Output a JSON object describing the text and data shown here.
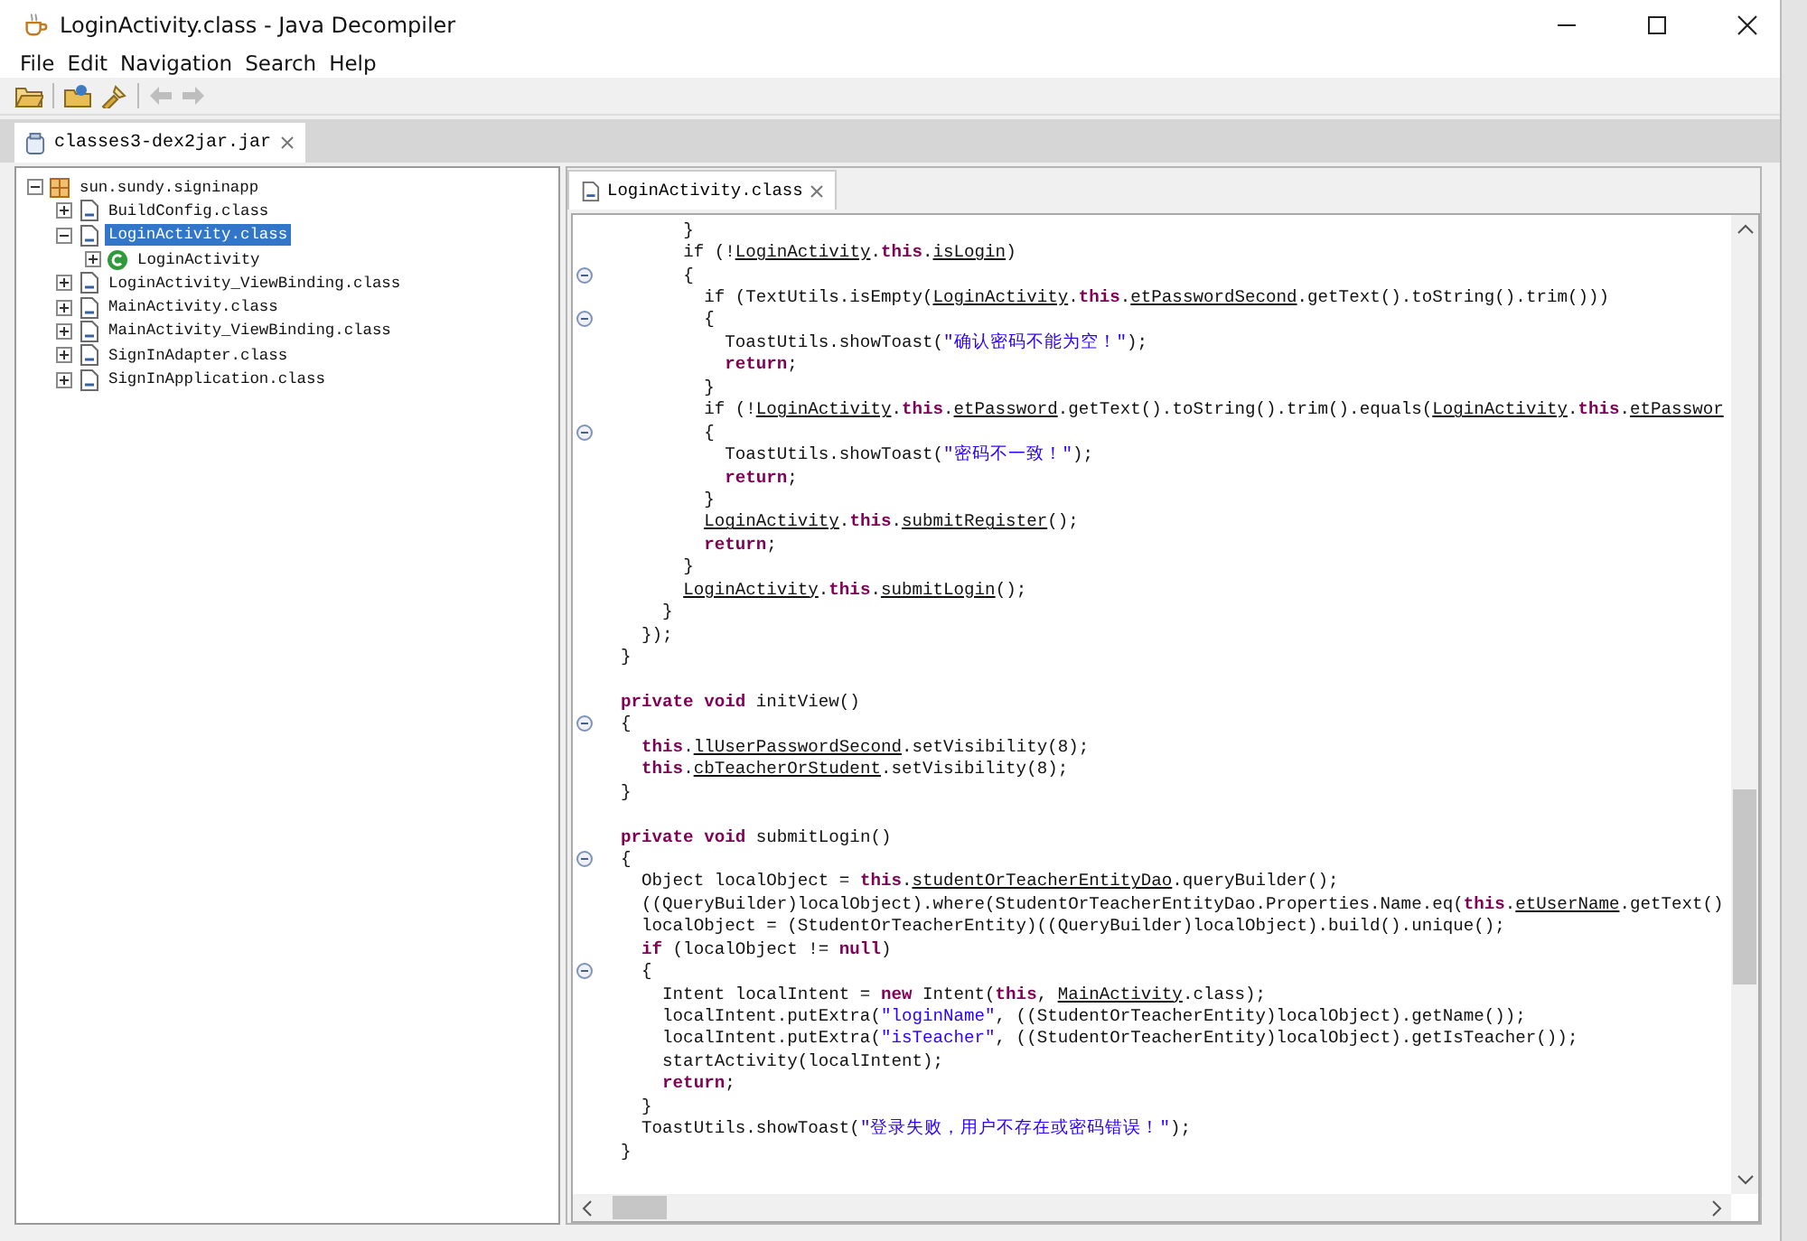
{
  "window": {
    "title": "LoginActivity.class - Java Decompiler"
  },
  "menu": [
    "File",
    "Edit",
    "Navigation",
    "Search",
    "Help"
  ],
  "toolbar": [
    {
      "kind": "open",
      "disabled": false
    },
    {
      "kind": "open-type",
      "disabled": false
    },
    {
      "kind": "search",
      "disabled": false
    },
    {
      "kind": "back",
      "disabled": true
    },
    {
      "kind": "forward",
      "disabled": true
    }
  ],
  "left_tabs": [
    {
      "label": "classes3-dex2jar.jar",
      "selected": true
    }
  ],
  "tree": [
    {
      "label": "sun.sundy.signinapp",
      "kind": "package",
      "expanded": true,
      "selected": false,
      "children": [
        {
          "label": "BuildConfig.class",
          "kind": "classfile",
          "expanded": false,
          "selected": false
        },
        {
          "label": "LoginActivity.class",
          "kind": "classfile",
          "expanded": true,
          "selected": true,
          "children": [
            {
              "label": "LoginActivity",
              "kind": "class",
              "expanded": false,
              "selected": false
            }
          ]
        },
        {
          "label": "LoginActivity_ViewBinding.class",
          "kind": "classfile",
          "expanded": false,
          "selected": false
        },
        {
          "label": "MainActivity.class",
          "kind": "classfile",
          "expanded": false,
          "selected": false
        },
        {
          "label": "MainActivity_ViewBinding.class",
          "kind": "classfile",
          "expanded": false,
          "selected": false
        },
        {
          "label": "SignInAdapter.class",
          "kind": "classfile",
          "expanded": false,
          "selected": false
        },
        {
          "label": "SignInApplication.class",
          "kind": "classfile",
          "expanded": false,
          "selected": false
        }
      ]
    }
  ],
  "editor_tabs": [
    {
      "label": "LoginActivity.class",
      "selected": true
    }
  ],
  "code": [
    {
      "kind": "code",
      "fold": false,
      "segments": [
        {
          "kind": "plain",
          "text": "        }"
        }
      ]
    },
    {
      "kind": "code",
      "fold": false,
      "segments": [
        {
          "kind": "plain",
          "text": "        if (!"
        },
        {
          "kind": "link",
          "text": "LoginActivity"
        },
        {
          "kind": "plain",
          "text": "."
        },
        {
          "kind": "keyword",
          "text": "this"
        },
        {
          "kind": "plain",
          "text": "."
        },
        {
          "kind": "link",
          "text": "isLogin"
        },
        {
          "kind": "plain",
          "text": ")"
        }
      ]
    },
    {
      "kind": "code",
      "fold": true,
      "segments": [
        {
          "kind": "plain",
          "text": "        {"
        }
      ]
    },
    {
      "kind": "code",
      "fold": false,
      "segments": [
        {
          "kind": "plain",
          "text": "          if (TextUtils.isEmpty("
        },
        {
          "kind": "link",
          "text": "LoginActivity"
        },
        {
          "kind": "plain",
          "text": "."
        },
        {
          "kind": "keyword",
          "text": "this"
        },
        {
          "kind": "plain",
          "text": "."
        },
        {
          "kind": "link",
          "text": "etPasswordSecond"
        },
        {
          "kind": "plain",
          "text": ".getText().toString().trim()))"
        }
      ]
    },
    {
      "kind": "code",
      "fold": true,
      "segments": [
        {
          "kind": "plain",
          "text": "          {"
        }
      ]
    },
    {
      "kind": "code",
      "fold": false,
      "segments": [
        {
          "kind": "plain",
          "text": "            ToastUtils.showToast("
        },
        {
          "kind": "string",
          "text": "\"确认密码不能为空！\""
        },
        {
          "kind": "plain",
          "text": ");"
        }
      ]
    },
    {
      "kind": "code",
      "fold": false,
      "segments": [
        {
          "kind": "keyword",
          "text": "            return"
        },
        {
          "kind": "plain",
          "text": ";"
        }
      ]
    },
    {
      "kind": "code",
      "fold": false,
      "segments": [
        {
          "kind": "plain",
          "text": "          }"
        }
      ]
    },
    {
      "kind": "code",
      "fold": false,
      "segments": [
        {
          "kind": "plain",
          "text": "          if (!"
        },
        {
          "kind": "link",
          "text": "LoginActivity"
        },
        {
          "kind": "plain",
          "text": "."
        },
        {
          "kind": "keyword",
          "text": "this"
        },
        {
          "kind": "plain",
          "text": "."
        },
        {
          "kind": "link",
          "text": "etPassword"
        },
        {
          "kind": "plain",
          "text": ".getText().toString().trim().equals("
        },
        {
          "kind": "link",
          "text": "LoginActivity"
        },
        {
          "kind": "plain",
          "text": "."
        },
        {
          "kind": "keyword",
          "text": "this"
        },
        {
          "kind": "plain",
          "text": "."
        },
        {
          "kind": "link",
          "text": "etPasswor"
        }
      ]
    },
    {
      "kind": "code",
      "fold": true,
      "segments": [
        {
          "kind": "plain",
          "text": "          {"
        }
      ]
    },
    {
      "kind": "code",
      "fold": false,
      "segments": [
        {
          "kind": "plain",
          "text": "            ToastUtils.showToast("
        },
        {
          "kind": "string",
          "text": "\"密码不一致！\""
        },
        {
          "kind": "plain",
          "text": ");"
        }
      ]
    },
    {
      "kind": "code",
      "fold": false,
      "segments": [
        {
          "kind": "keyword",
          "text": "            return"
        },
        {
          "kind": "plain",
          "text": ";"
        }
      ]
    },
    {
      "kind": "code",
      "fold": false,
      "segments": [
        {
          "kind": "plain",
          "text": "          }"
        }
      ]
    },
    {
      "kind": "code",
      "fold": false,
      "segments": [
        {
          "kind": "link",
          "text": "          LoginActivity"
        },
        {
          "kind": "plain",
          "text": "."
        },
        {
          "kind": "keyword",
          "text": "this"
        },
        {
          "kind": "plain",
          "text": "."
        },
        {
          "kind": "link",
          "text": "submitRegister"
        },
        {
          "kind": "plain",
          "text": "();"
        }
      ]
    },
    {
      "kind": "code",
      "fold": false,
      "segments": [
        {
          "kind": "keyword",
          "text": "          return"
        },
        {
          "kind": "plain",
          "text": ";"
        }
      ]
    },
    {
      "kind": "code",
      "fold": false,
      "segments": [
        {
          "kind": "plain",
          "text": "        }"
        }
      ]
    },
    {
      "kind": "code",
      "fold": false,
      "segments": [
        {
          "kind": "link",
          "text": "        LoginActivity"
        },
        {
          "kind": "plain",
          "text": "."
        },
        {
          "kind": "keyword",
          "text": "this"
        },
        {
          "kind": "plain",
          "text": "."
        },
        {
          "kind": "link",
          "text": "submitLogin"
        },
        {
          "kind": "plain",
          "text": "();"
        }
      ]
    },
    {
      "kind": "code",
      "fold": false,
      "segments": [
        {
          "kind": "plain",
          "text": "      }"
        }
      ]
    },
    {
      "kind": "code",
      "fold": false,
      "segments": [
        {
          "kind": "plain",
          "text": "    });"
        }
      ]
    },
    {
      "kind": "code",
      "fold": false,
      "segments": [
        {
          "kind": "plain",
          "text": "  }"
        }
      ]
    },
    {
      "kind": "blank"
    },
    {
      "kind": "code",
      "fold": false,
      "segments": [
        {
          "kind": "keyword",
          "text": "  private void"
        },
        {
          "kind": "plain",
          "text": " initView()"
        }
      ]
    },
    {
      "kind": "code",
      "fold": true,
      "segments": [
        {
          "kind": "plain",
          "text": "  {"
        }
      ]
    },
    {
      "kind": "code",
      "fold": false,
      "segments": [
        {
          "kind": "keyword",
          "text": "    this"
        },
        {
          "kind": "plain",
          "text": "."
        },
        {
          "kind": "link",
          "text": "llUserPasswordSecond"
        },
        {
          "kind": "plain",
          "text": ".setVisibility(8);"
        }
      ]
    },
    {
      "kind": "code",
      "fold": false,
      "segments": [
        {
          "kind": "keyword",
          "text": "    this"
        },
        {
          "kind": "plain",
          "text": "."
        },
        {
          "kind": "link",
          "text": "cbTeacherOrStudent"
        },
        {
          "kind": "plain",
          "text": ".setVisibility(8);"
        }
      ]
    },
    {
      "kind": "code",
      "fold": false,
      "segments": [
        {
          "kind": "plain",
          "text": "  }"
        }
      ]
    },
    {
      "kind": "blank"
    },
    {
      "kind": "code",
      "fold": false,
      "segments": [
        {
          "kind": "keyword",
          "text": "  private void"
        },
        {
          "kind": "plain",
          "text": " submitLogin()"
        }
      ]
    },
    {
      "kind": "code",
      "fold": true,
      "segments": [
        {
          "kind": "plain",
          "text": "  {"
        }
      ]
    },
    {
      "kind": "code",
      "fold": false,
      "segments": [
        {
          "kind": "plain",
          "text": "    Object localObject = "
        },
        {
          "kind": "keyword",
          "text": "this"
        },
        {
          "kind": "plain",
          "text": "."
        },
        {
          "kind": "link",
          "text": "studentOrTeacherEntityDao"
        },
        {
          "kind": "plain",
          "text": ".queryBuilder();"
        }
      ]
    },
    {
      "kind": "code",
      "fold": false,
      "segments": [
        {
          "kind": "plain",
          "text": "    ((QueryBuilder)localObject).where(StudentOrTeacherEntityDao.Properties.Name.eq("
        },
        {
          "kind": "keyword",
          "text": "this"
        },
        {
          "kind": "plain",
          "text": "."
        },
        {
          "kind": "link",
          "text": "etUserName"
        },
        {
          "kind": "plain",
          "text": ".getText()"
        }
      ]
    },
    {
      "kind": "code",
      "fold": false,
      "segments": [
        {
          "kind": "plain",
          "text": "    localObject = (StudentOrTeacherEntity)((QueryBuilder)localObject).build().unique();"
        }
      ]
    },
    {
      "kind": "code",
      "fold": false,
      "segments": [
        {
          "kind": "keyword",
          "text": "    if"
        },
        {
          "kind": "plain",
          "text": " (localObject != "
        },
        {
          "kind": "keyword",
          "text": "null"
        },
        {
          "kind": "plain",
          "text": ")"
        }
      ]
    },
    {
      "kind": "code",
      "fold": true,
      "segments": [
        {
          "kind": "plain",
          "text": "    {"
        }
      ]
    },
    {
      "kind": "code",
      "fold": false,
      "segments": [
        {
          "kind": "plain",
          "text": "      Intent localIntent = "
        },
        {
          "kind": "keyword",
          "text": "new"
        },
        {
          "kind": "plain",
          "text": " Intent("
        },
        {
          "kind": "keyword",
          "text": "this"
        },
        {
          "kind": "plain",
          "text": ", "
        },
        {
          "kind": "link",
          "text": "MainActivity"
        },
        {
          "kind": "plain",
          "text": ".class);"
        }
      ]
    },
    {
      "kind": "code",
      "fold": false,
      "segments": [
        {
          "kind": "plain",
          "text": "      localIntent.putExtra("
        },
        {
          "kind": "string",
          "text": "\"loginName\""
        },
        {
          "kind": "plain",
          "text": ", ((StudentOrTeacherEntity)localObject).getName());"
        }
      ]
    },
    {
      "kind": "code",
      "fold": false,
      "segments": [
        {
          "kind": "plain",
          "text": "      localIntent.putExtra("
        },
        {
          "kind": "string",
          "text": "\"isTeacher\""
        },
        {
          "kind": "plain",
          "text": ", ((StudentOrTeacherEntity)localObject).getIsTeacher());"
        }
      ]
    },
    {
      "kind": "code",
      "fold": false,
      "segments": [
        {
          "kind": "plain",
          "text": "      startActivity(localIntent);"
        }
      ]
    },
    {
      "kind": "code",
      "fold": false,
      "segments": [
        {
          "kind": "keyword",
          "text": "      return"
        },
        {
          "kind": "plain",
          "text": ";"
        }
      ]
    },
    {
      "kind": "code",
      "fold": false,
      "segments": [
        {
          "kind": "plain",
          "text": "    }"
        }
      ]
    },
    {
      "kind": "code",
      "fold": false,
      "segments": [
        {
          "kind": "plain",
          "text": "    ToastUtils.showToast("
        },
        {
          "kind": "string",
          "text": "\"登录失败，用户不存在或密码错误！\""
        },
        {
          "kind": "plain",
          "text": ");"
        }
      ]
    },
    {
      "kind": "code",
      "fold": false,
      "segments": [
        {
          "kind": "plain",
          "text": "  }"
        }
      ]
    }
  ]
}
